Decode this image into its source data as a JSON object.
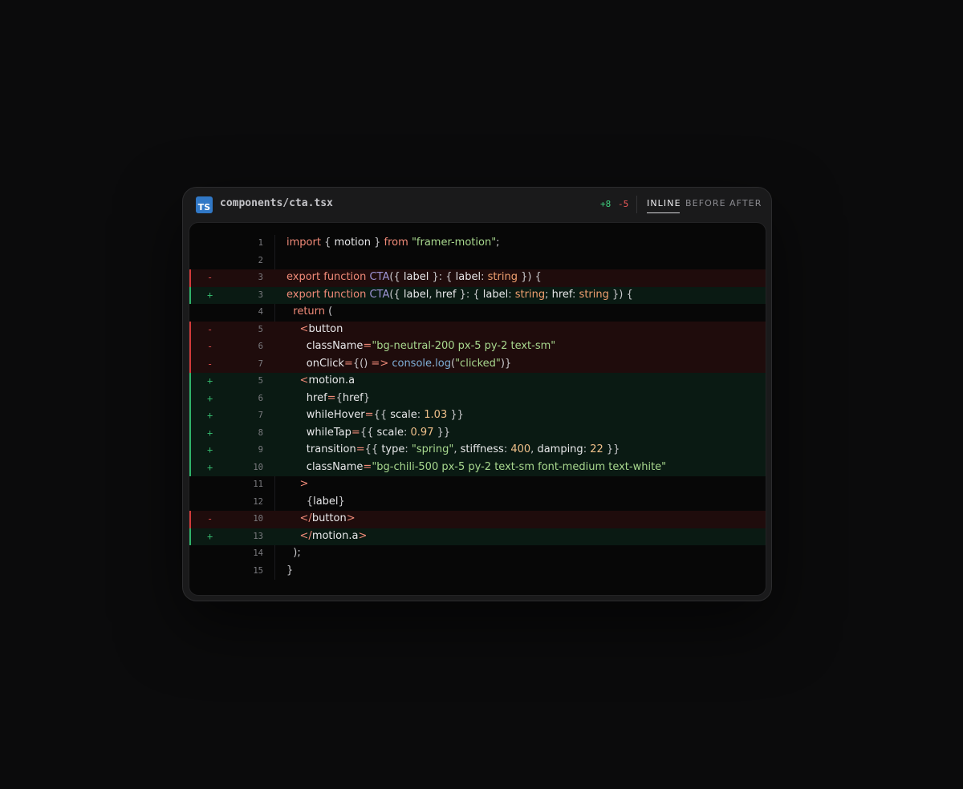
{
  "file": {
    "language_badge": "TS",
    "name": "components/cta.tsx",
    "additions": "+8",
    "deletions": "-5"
  },
  "tabs": [
    {
      "label": "INLINE",
      "active": true
    },
    {
      "label": "BEFORE",
      "active": false
    },
    {
      "label": "AFTER",
      "active": false
    }
  ],
  "colors": {
    "added": "#34b56b",
    "removed": "#d24848",
    "ts_badge": "#3178c6"
  },
  "lines": [
    {
      "type": "context",
      "marker": "",
      "num": "1",
      "tokens": [
        [
          "kw",
          "import "
        ],
        [
          "punc",
          "{ "
        ],
        [
          "plain",
          "motion"
        ],
        [
          "punc",
          " } "
        ],
        [
          "kw",
          "from "
        ],
        [
          "str",
          "\"framer-motion\""
        ],
        [
          "punc",
          ";"
        ]
      ]
    },
    {
      "type": "context",
      "marker": "",
      "num": "2",
      "tokens": []
    },
    {
      "type": "del",
      "marker": "-",
      "num": "3",
      "tokens": [
        [
          "kw",
          "export function "
        ],
        [
          "fn",
          "CTA"
        ],
        [
          "punc",
          "({ "
        ],
        [
          "plain",
          "label"
        ],
        [
          "punc",
          " }: { "
        ],
        [
          "plain",
          "label"
        ],
        [
          "punc",
          ": "
        ],
        [
          "type",
          "string"
        ],
        [
          "punc",
          " }) {"
        ]
      ]
    },
    {
      "type": "add",
      "marker": "+",
      "num": "3",
      "tokens": [
        [
          "kw",
          "export function "
        ],
        [
          "fn",
          "CTA"
        ],
        [
          "punc",
          "({ "
        ],
        [
          "plain",
          "label"
        ],
        [
          "punc",
          ", "
        ],
        [
          "plain",
          "href"
        ],
        [
          "punc",
          " }: { "
        ],
        [
          "plain",
          "label"
        ],
        [
          "punc",
          ": "
        ],
        [
          "type",
          "string"
        ],
        [
          "punc",
          "; "
        ],
        [
          "plain",
          "href"
        ],
        [
          "punc",
          ": "
        ],
        [
          "type",
          "string"
        ],
        [
          "punc",
          " }) {"
        ]
      ]
    },
    {
      "type": "context",
      "marker": "",
      "num": "4",
      "tokens": [
        [
          "plain",
          "  "
        ],
        [
          "kw",
          "return "
        ],
        [
          "punc",
          "("
        ]
      ]
    },
    {
      "type": "del",
      "marker": "-",
      "num": "5",
      "tokens": [
        [
          "plain",
          "    "
        ],
        [
          "tag",
          "<"
        ],
        [
          "plain",
          "button"
        ]
      ]
    },
    {
      "type": "del",
      "marker": "-",
      "num": "6",
      "tokens": [
        [
          "plain",
          "      className"
        ],
        [
          "kw",
          "="
        ],
        [
          "str",
          "\"bg-neutral-200 px-5 py-2 text-sm\""
        ]
      ]
    },
    {
      "type": "del",
      "marker": "-",
      "num": "7",
      "tokens": [
        [
          "plain",
          "      onClick"
        ],
        [
          "kw",
          "="
        ],
        [
          "punc",
          "{() "
        ],
        [
          "kw",
          "=> "
        ],
        [
          "fn2",
          "console"
        ],
        [
          "punc",
          "."
        ],
        [
          "fn2",
          "log"
        ],
        [
          "punc",
          "("
        ],
        [
          "str",
          "\"clicked\""
        ],
        [
          "punc",
          ")}"
        ]
      ]
    },
    {
      "type": "add",
      "marker": "+",
      "num": "5",
      "tokens": [
        [
          "plain",
          "    "
        ],
        [
          "tag",
          "<"
        ],
        [
          "plain",
          "motion.a"
        ]
      ]
    },
    {
      "type": "add",
      "marker": "+",
      "num": "6",
      "tokens": [
        [
          "plain",
          "      href"
        ],
        [
          "kw",
          "="
        ],
        [
          "punc",
          "{"
        ],
        [
          "plain",
          "href"
        ],
        [
          "punc",
          "}"
        ]
      ]
    },
    {
      "type": "add",
      "marker": "+",
      "num": "7",
      "tokens": [
        [
          "plain",
          "      whileHover"
        ],
        [
          "kw",
          "="
        ],
        [
          "punc",
          "{{ "
        ],
        [
          "plain",
          "scale"
        ],
        [
          "punc",
          ": "
        ],
        [
          "num",
          "1.03"
        ],
        [
          "punc",
          " }}"
        ]
      ]
    },
    {
      "type": "add",
      "marker": "+",
      "num": "8",
      "tokens": [
        [
          "plain",
          "      whileTap"
        ],
        [
          "kw",
          "="
        ],
        [
          "punc",
          "{{ "
        ],
        [
          "plain",
          "scale"
        ],
        [
          "punc",
          ": "
        ],
        [
          "num",
          "0.97"
        ],
        [
          "punc",
          " }}"
        ]
      ]
    },
    {
      "type": "add",
      "marker": "+",
      "num": "9",
      "tokens": [
        [
          "plain",
          "      transition"
        ],
        [
          "kw",
          "="
        ],
        [
          "punc",
          "{{ "
        ],
        [
          "plain",
          "type"
        ],
        [
          "punc",
          ": "
        ],
        [
          "str",
          "\"spring\""
        ],
        [
          "punc",
          ", "
        ],
        [
          "plain",
          "stiffness"
        ],
        [
          "punc",
          ": "
        ],
        [
          "num",
          "400"
        ],
        [
          "punc",
          ", "
        ],
        [
          "plain",
          "damping"
        ],
        [
          "punc",
          ": "
        ],
        [
          "num",
          "22"
        ],
        [
          "punc",
          " }}"
        ]
      ]
    },
    {
      "type": "add",
      "marker": "+",
      "num": "10",
      "tokens": [
        [
          "plain",
          "      className"
        ],
        [
          "kw",
          "="
        ],
        [
          "str",
          "\"bg-chili-500 px-5 py-2 text-sm font-medium text-white\""
        ]
      ]
    },
    {
      "type": "context",
      "marker": "",
      "num": "11",
      "tokens": [
        [
          "plain",
          "    "
        ],
        [
          "tag",
          ">"
        ]
      ]
    },
    {
      "type": "context",
      "marker": "",
      "num": "12",
      "tokens": [
        [
          "plain",
          "      "
        ],
        [
          "punc",
          "{"
        ],
        [
          "plain",
          "label"
        ],
        [
          "punc",
          "}"
        ]
      ]
    },
    {
      "type": "del",
      "marker": "-",
      "num": "10",
      "tokens": [
        [
          "plain",
          "    "
        ],
        [
          "tag",
          "</"
        ],
        [
          "plain",
          "button"
        ],
        [
          "tag",
          ">"
        ]
      ]
    },
    {
      "type": "add",
      "marker": "+",
      "num": "13",
      "tokens": [
        [
          "plain",
          "    "
        ],
        [
          "tag",
          "</"
        ],
        [
          "plain",
          "motion.a"
        ],
        [
          "tag",
          ">"
        ]
      ]
    },
    {
      "type": "context",
      "marker": "",
      "num": "14",
      "tokens": [
        [
          "punc",
          "  );"
        ]
      ]
    },
    {
      "type": "context",
      "marker": "",
      "num": "15",
      "tokens": [
        [
          "punc",
          "}"
        ]
      ]
    }
  ]
}
